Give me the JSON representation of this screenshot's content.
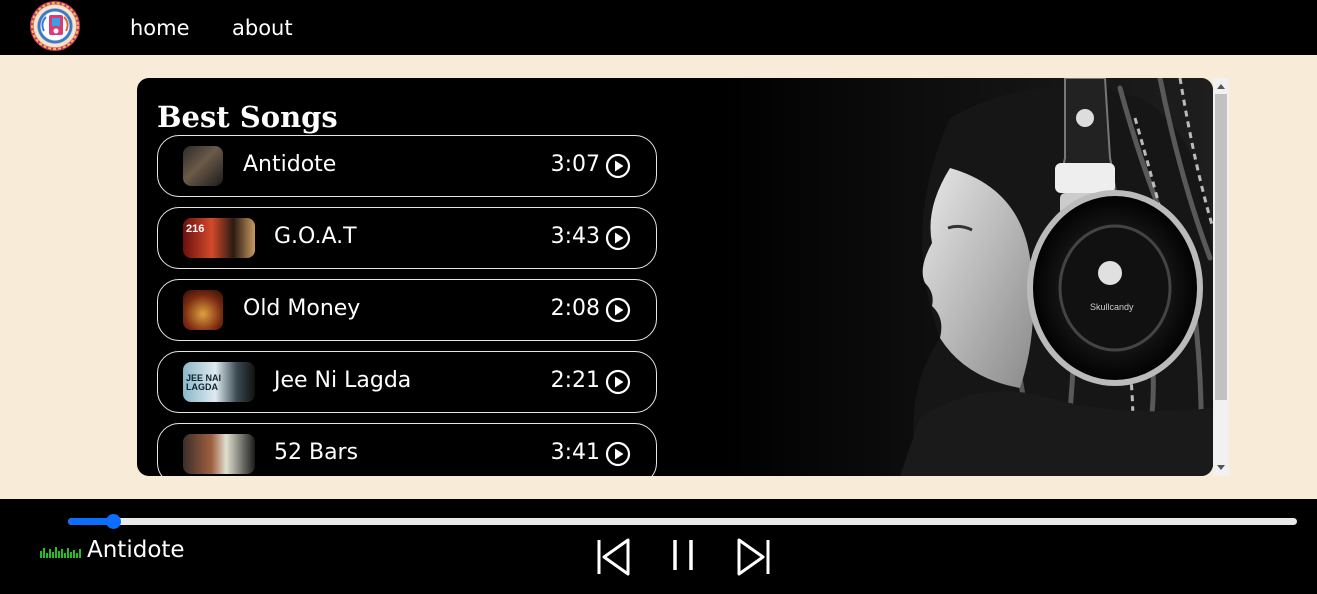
{
  "nav": {
    "logo_icon": "music-logo-icon",
    "links": [
      {
        "label": "home"
      },
      {
        "label": "about"
      }
    ]
  },
  "card": {
    "title": "Best Songs",
    "songs": [
      {
        "name": "Antidote",
        "duration": "3:07",
        "thumb_icon": "album-cover-antidote"
      },
      {
        "name": "G.O.A.T",
        "duration": "3:43",
        "thumb_icon": "album-cover-goat",
        "thumb_text": "216"
      },
      {
        "name": "Old Money",
        "duration": "2:08",
        "thumb_icon": "album-cover-old-money"
      },
      {
        "name": "Jee Ni Lagda",
        "duration": "2:21",
        "thumb_icon": "album-cover-jee-ni-lagda",
        "thumb_text": "JEE NAI LAGDA"
      },
      {
        "name": "52 Bars",
        "duration": "3:41",
        "thumb_icon": "album-cover-52-bars"
      }
    ],
    "play_icon": "play-circle-icon",
    "hero_image": "woman-with-headphones-photo",
    "hero_brand": "Skullcandy"
  },
  "player": {
    "current_song": "Antidote",
    "progress": 0.037,
    "equalizer_icon": "equalizer-gif-icon",
    "controls": [
      {
        "icon": "skip-previous-icon"
      },
      {
        "icon": "pause-icon"
      },
      {
        "icon": "skip-next-icon"
      }
    ],
    "accent_color": "#0d6efd"
  }
}
